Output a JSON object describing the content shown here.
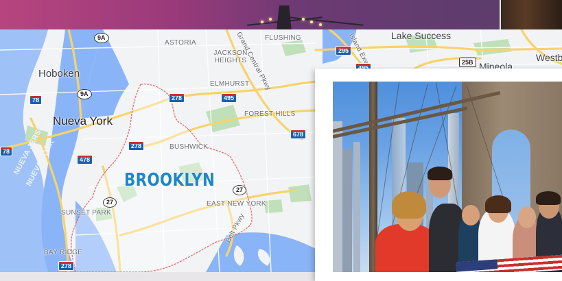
{
  "map": {
    "places": {
      "hoboken": "Hoboken",
      "nueva_york": "Nueva York",
      "brooklyn": "BROOKLYN",
      "astoria": "ASTORIA",
      "flushing": "FLUSHING",
      "jackson_heights": "JACKSON\nHEIGHTS",
      "elmhurst": "ELMHURST",
      "forest_hills": "FOREST HILLS",
      "bushwick": "BUSHWICK",
      "east_new_york": "EAST NEW YORK",
      "sunset_park": "SUNSET PARK",
      "bay_ridge": "BAY RIDGE",
      "lake_success": "Lake Success",
      "mineola": "Mineola",
      "westbury": "Westb"
    },
    "water": {
      "nueva_jersey": "NUEVA JERSEY",
      "nueva_york": "NUEVA YORK"
    },
    "roads": {
      "grand_central": "Grand Central Pkwy",
      "belt_pkwy": "Belt Pkwy",
      "island_exwy": "Island Exwy"
    },
    "shields": {
      "r9a_top": "9A",
      "r9a_mid": "9A",
      "i78_left": "78",
      "i78_edge": "78",
      "i478": "478",
      "i278_north": "278",
      "i278_mid": "278",
      "i278_south": "278",
      "i495_mid": "495",
      "i495_top": "495",
      "i295": "295",
      "i678": "678",
      "r25b": "25B",
      "r27_east": "27",
      "r27_west": "27"
    }
  },
  "colors": {
    "brooklyn_label": "#1f86c8",
    "boundary": "#e06a6a",
    "water": "#8ab4f8",
    "highway": "#f7d36b",
    "park": "#bfe0b8"
  }
}
